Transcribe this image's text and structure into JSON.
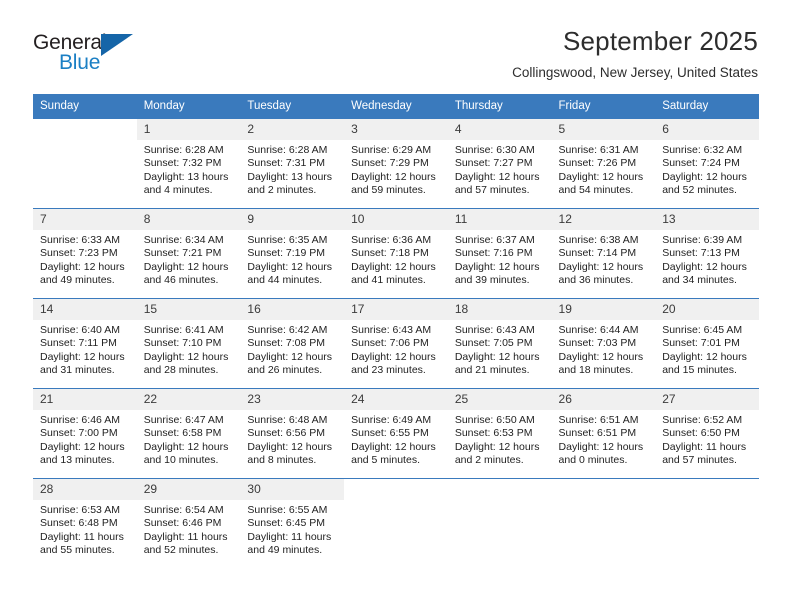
{
  "brand": {
    "name_dark": "General",
    "name_blue": "Blue",
    "accent_color": "#1b7fc4",
    "triangle_color": "#1565a8"
  },
  "header": {
    "title": "September 2025",
    "subtitle": "Collingswood, New Jersey, United States"
  },
  "calendar": {
    "header_bg": "#3a7abd",
    "daynum_bg": "#f0f0f0",
    "weekday_headers": [
      "Sunday",
      "Monday",
      "Tuesday",
      "Wednesday",
      "Thursday",
      "Friday",
      "Saturday"
    ],
    "weeks": [
      [
        {
          "day": "",
          "sunrise": "",
          "sunset": "",
          "daylight_1": "",
          "daylight_2": ""
        },
        {
          "day": "1",
          "sunrise": "Sunrise: 6:28 AM",
          "sunset": "Sunset: 7:32 PM",
          "daylight_1": "Daylight: 13 hours",
          "daylight_2": "and 4 minutes."
        },
        {
          "day": "2",
          "sunrise": "Sunrise: 6:28 AM",
          "sunset": "Sunset: 7:31 PM",
          "daylight_1": "Daylight: 13 hours",
          "daylight_2": "and 2 minutes."
        },
        {
          "day": "3",
          "sunrise": "Sunrise: 6:29 AM",
          "sunset": "Sunset: 7:29 PM",
          "daylight_1": "Daylight: 12 hours",
          "daylight_2": "and 59 minutes."
        },
        {
          "day": "4",
          "sunrise": "Sunrise: 6:30 AM",
          "sunset": "Sunset: 7:27 PM",
          "daylight_1": "Daylight: 12 hours",
          "daylight_2": "and 57 minutes."
        },
        {
          "day": "5",
          "sunrise": "Sunrise: 6:31 AM",
          "sunset": "Sunset: 7:26 PM",
          "daylight_1": "Daylight: 12 hours",
          "daylight_2": "and 54 minutes."
        },
        {
          "day": "6",
          "sunrise": "Sunrise: 6:32 AM",
          "sunset": "Sunset: 7:24 PM",
          "daylight_1": "Daylight: 12 hours",
          "daylight_2": "and 52 minutes."
        }
      ],
      [
        {
          "day": "7",
          "sunrise": "Sunrise: 6:33 AM",
          "sunset": "Sunset: 7:23 PM",
          "daylight_1": "Daylight: 12 hours",
          "daylight_2": "and 49 minutes."
        },
        {
          "day": "8",
          "sunrise": "Sunrise: 6:34 AM",
          "sunset": "Sunset: 7:21 PM",
          "daylight_1": "Daylight: 12 hours",
          "daylight_2": "and 46 minutes."
        },
        {
          "day": "9",
          "sunrise": "Sunrise: 6:35 AM",
          "sunset": "Sunset: 7:19 PM",
          "daylight_1": "Daylight: 12 hours",
          "daylight_2": "and 44 minutes."
        },
        {
          "day": "10",
          "sunrise": "Sunrise: 6:36 AM",
          "sunset": "Sunset: 7:18 PM",
          "daylight_1": "Daylight: 12 hours",
          "daylight_2": "and 41 minutes."
        },
        {
          "day": "11",
          "sunrise": "Sunrise: 6:37 AM",
          "sunset": "Sunset: 7:16 PM",
          "daylight_1": "Daylight: 12 hours",
          "daylight_2": "and 39 minutes."
        },
        {
          "day": "12",
          "sunrise": "Sunrise: 6:38 AM",
          "sunset": "Sunset: 7:14 PM",
          "daylight_1": "Daylight: 12 hours",
          "daylight_2": "and 36 minutes."
        },
        {
          "day": "13",
          "sunrise": "Sunrise: 6:39 AM",
          "sunset": "Sunset: 7:13 PM",
          "daylight_1": "Daylight: 12 hours",
          "daylight_2": "and 34 minutes."
        }
      ],
      [
        {
          "day": "14",
          "sunrise": "Sunrise: 6:40 AM",
          "sunset": "Sunset: 7:11 PM",
          "daylight_1": "Daylight: 12 hours",
          "daylight_2": "and 31 minutes."
        },
        {
          "day": "15",
          "sunrise": "Sunrise: 6:41 AM",
          "sunset": "Sunset: 7:10 PM",
          "daylight_1": "Daylight: 12 hours",
          "daylight_2": "and 28 minutes."
        },
        {
          "day": "16",
          "sunrise": "Sunrise: 6:42 AM",
          "sunset": "Sunset: 7:08 PM",
          "daylight_1": "Daylight: 12 hours",
          "daylight_2": "and 26 minutes."
        },
        {
          "day": "17",
          "sunrise": "Sunrise: 6:43 AM",
          "sunset": "Sunset: 7:06 PM",
          "daylight_1": "Daylight: 12 hours",
          "daylight_2": "and 23 minutes."
        },
        {
          "day": "18",
          "sunrise": "Sunrise: 6:43 AM",
          "sunset": "Sunset: 7:05 PM",
          "daylight_1": "Daylight: 12 hours",
          "daylight_2": "and 21 minutes."
        },
        {
          "day": "19",
          "sunrise": "Sunrise: 6:44 AM",
          "sunset": "Sunset: 7:03 PM",
          "daylight_1": "Daylight: 12 hours",
          "daylight_2": "and 18 minutes."
        },
        {
          "day": "20",
          "sunrise": "Sunrise: 6:45 AM",
          "sunset": "Sunset: 7:01 PM",
          "daylight_1": "Daylight: 12 hours",
          "daylight_2": "and 15 minutes."
        }
      ],
      [
        {
          "day": "21",
          "sunrise": "Sunrise: 6:46 AM",
          "sunset": "Sunset: 7:00 PM",
          "daylight_1": "Daylight: 12 hours",
          "daylight_2": "and 13 minutes."
        },
        {
          "day": "22",
          "sunrise": "Sunrise: 6:47 AM",
          "sunset": "Sunset: 6:58 PM",
          "daylight_1": "Daylight: 12 hours",
          "daylight_2": "and 10 minutes."
        },
        {
          "day": "23",
          "sunrise": "Sunrise: 6:48 AM",
          "sunset": "Sunset: 6:56 PM",
          "daylight_1": "Daylight: 12 hours",
          "daylight_2": "and 8 minutes."
        },
        {
          "day": "24",
          "sunrise": "Sunrise: 6:49 AM",
          "sunset": "Sunset: 6:55 PM",
          "daylight_1": "Daylight: 12 hours",
          "daylight_2": "and 5 minutes."
        },
        {
          "day": "25",
          "sunrise": "Sunrise: 6:50 AM",
          "sunset": "Sunset: 6:53 PM",
          "daylight_1": "Daylight: 12 hours",
          "daylight_2": "and 2 minutes."
        },
        {
          "day": "26",
          "sunrise": "Sunrise: 6:51 AM",
          "sunset": "Sunset: 6:51 PM",
          "daylight_1": "Daylight: 12 hours",
          "daylight_2": "and 0 minutes."
        },
        {
          "day": "27",
          "sunrise": "Sunrise: 6:52 AM",
          "sunset": "Sunset: 6:50 PM",
          "daylight_1": "Daylight: 11 hours",
          "daylight_2": "and 57 minutes."
        }
      ],
      [
        {
          "day": "28",
          "sunrise": "Sunrise: 6:53 AM",
          "sunset": "Sunset: 6:48 PM",
          "daylight_1": "Daylight: 11 hours",
          "daylight_2": "and 55 minutes."
        },
        {
          "day": "29",
          "sunrise": "Sunrise: 6:54 AM",
          "sunset": "Sunset: 6:46 PM",
          "daylight_1": "Daylight: 11 hours",
          "daylight_2": "and 52 minutes."
        },
        {
          "day": "30",
          "sunrise": "Sunrise: 6:55 AM",
          "sunset": "Sunset: 6:45 PM",
          "daylight_1": "Daylight: 11 hours",
          "daylight_2": "and 49 minutes."
        },
        {
          "day": "",
          "sunrise": "",
          "sunset": "",
          "daylight_1": "",
          "daylight_2": ""
        },
        {
          "day": "",
          "sunrise": "",
          "sunset": "",
          "daylight_1": "",
          "daylight_2": ""
        },
        {
          "day": "",
          "sunrise": "",
          "sunset": "",
          "daylight_1": "",
          "daylight_2": ""
        },
        {
          "day": "",
          "sunrise": "",
          "sunset": "",
          "daylight_1": "",
          "daylight_2": ""
        }
      ]
    ]
  }
}
